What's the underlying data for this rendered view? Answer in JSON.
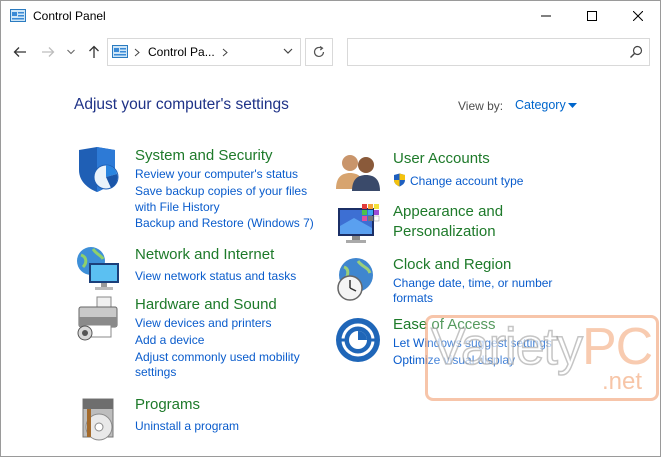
{
  "window": {
    "title": "Control Panel"
  },
  "navbar": {
    "breadcrumb": "Control Pa...",
    "search_placeholder": ""
  },
  "main": {
    "heading": "Adjust your computer's settings",
    "view_by_label": "View by:",
    "view_by_value": "Category"
  },
  "categories": {
    "system_security": {
      "title": "System and Security",
      "links": [
        "Review your computer's status",
        "Save backup copies of your files",
        "with File History",
        "Backup and Restore (Windows 7)"
      ]
    },
    "network": {
      "title": "Network and Internet",
      "links": [
        "View network status and tasks"
      ]
    },
    "hardware": {
      "title": "Hardware and Sound",
      "links": [
        "View devices and printers",
        "Add a device",
        "Adjust commonly used mobility",
        "settings"
      ]
    },
    "programs": {
      "title": "Programs",
      "links": [
        "Uninstall a program"
      ]
    },
    "user_accounts": {
      "title": "User Accounts",
      "links": [
        "Change account type"
      ]
    },
    "appearance": {
      "title": [
        "Appearance and",
        "Personalization"
      ]
    },
    "clock": {
      "title": "Clock and Region",
      "links": [
        "Change date, time, or number",
        "formats"
      ]
    },
    "ease": {
      "title": "Ease of Access",
      "links": [
        "Let Windows suggest settings",
        "Optimize visual display"
      ]
    }
  },
  "watermark": {
    "word": "Variety",
    "suffix": "PC",
    "domain": ".net"
  },
  "colors": {
    "heading": "#1e3287",
    "category_title": "#1e7a2a",
    "link": "#0a5ccc"
  }
}
